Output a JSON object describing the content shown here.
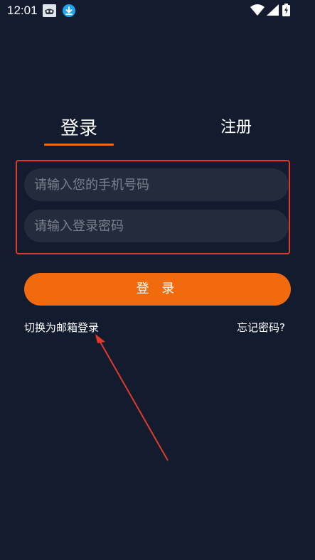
{
  "status_bar": {
    "time": "12:01",
    "icons": [
      "app-notification-icon",
      "download-icon",
      "wifi-icon",
      "signal-icon",
      "battery-charging-icon"
    ]
  },
  "tabs": [
    {
      "label": "登录",
      "active": true
    },
    {
      "label": "注册",
      "active": false
    }
  ],
  "form": {
    "phone_placeholder": "请输入您的手机号码",
    "password_placeholder": "请输入登录密码",
    "login_button": "登 录"
  },
  "links": {
    "switch_email": "切换为邮箱登录",
    "forgot_password": "忘记密码?"
  },
  "colors": {
    "background": "#131b2e",
    "accent": "#f26a0e",
    "field_bg": "#232b3c",
    "annotation": "#e03a2b"
  }
}
